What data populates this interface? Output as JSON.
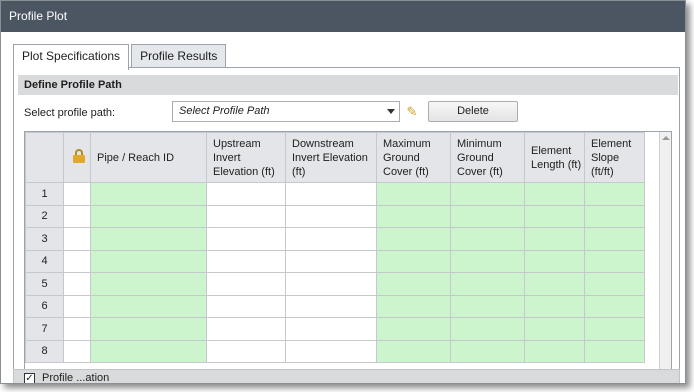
{
  "window": {
    "title": "Profile Plot"
  },
  "tabs": [
    {
      "label": "Plot Specifications",
      "active": true
    },
    {
      "label": "Profile Results",
      "active": false
    }
  ],
  "section": {
    "title": "Define Profile Path"
  },
  "path_selector": {
    "label": "Select profile path:",
    "value": "Select Profile Path",
    "delete_label": "Delete"
  },
  "grid": {
    "columns": [
      {
        "id": "lock",
        "label": ""
      },
      {
        "id": "pipe",
        "label": "Pipe / Reach ID"
      },
      {
        "id": "up",
        "label": "Upstream Invert Elevation (ft)"
      },
      {
        "id": "down",
        "label": "Downstream Invert Elevation (ft)"
      },
      {
        "id": "maxcov",
        "label": "Maximum Ground Cover (ft)"
      },
      {
        "id": "mincov",
        "label": "Minimum Ground Cover (ft)"
      },
      {
        "id": "len",
        "label": "Element Length (ft)"
      },
      {
        "id": "slope",
        "label": "Element Slope (ft/ft)"
      }
    ],
    "rows": [
      "1",
      "2",
      "3",
      "4",
      "5",
      "6",
      "7",
      "8"
    ]
  },
  "bottom": {
    "label": "Profile ...ation",
    "checked": true
  },
  "colors": {
    "editable_cell": "#cdf5cd",
    "titlebar": "#4c5663"
  }
}
